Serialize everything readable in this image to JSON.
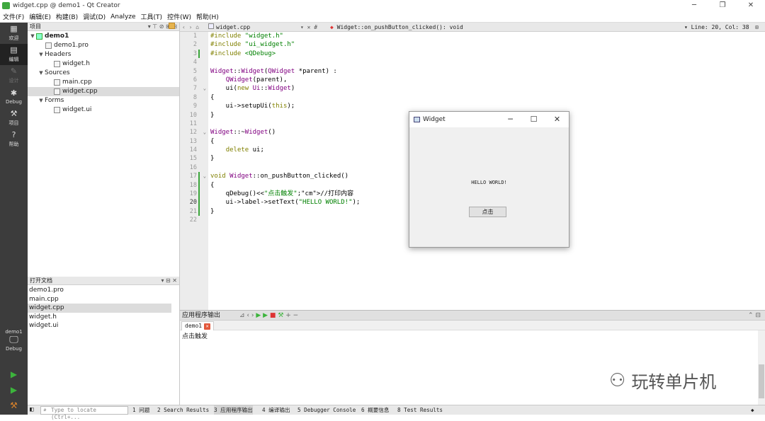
{
  "window": {
    "title": "widget.cpp @ demo1 - Qt Creator"
  },
  "menu": [
    "文件(F)",
    "编辑(E)",
    "构建(B)",
    "调试(D)",
    "Analyze",
    "工具(T)",
    "控件(W)",
    "帮助(H)"
  ],
  "modes": [
    {
      "label": "欢迎",
      "icon": "grid-icon"
    },
    {
      "label": "编辑",
      "icon": "edit-icon"
    },
    {
      "label": "设计",
      "icon": "pencil-icon"
    },
    {
      "label": "Debug",
      "icon": "bug-icon"
    },
    {
      "label": "项目",
      "icon": "wrench-icon"
    },
    {
      "label": "帮助",
      "icon": "help-icon"
    }
  ],
  "kit": {
    "project": "demo1",
    "config": "Debug"
  },
  "projects_pane": {
    "title": "项目",
    "tree": [
      {
        "label": "demo1",
        "level": 0,
        "kind": "project"
      },
      {
        "label": "demo1.pro",
        "level": 1,
        "kind": "file"
      },
      {
        "label": "Headers",
        "level": 1,
        "kind": "folder"
      },
      {
        "label": "widget.h",
        "level": 2,
        "kind": "file"
      },
      {
        "label": "Sources",
        "level": 1,
        "kind": "folder"
      },
      {
        "label": "main.cpp",
        "level": 2,
        "kind": "file"
      },
      {
        "label": "widget.cpp",
        "level": 2,
        "kind": "file"
      },
      {
        "label": "Forms",
        "level": 1,
        "kind": "folder"
      },
      {
        "label": "widget.ui",
        "level": 2,
        "kind": "file"
      }
    ]
  },
  "open_docs": {
    "title": "打开文档",
    "items": [
      "demo1.pro",
      "main.cpp",
      "widget.cpp",
      "widget.h",
      "widget.ui"
    ],
    "selected": "widget.cpp"
  },
  "editor": {
    "file": "widget.cpp",
    "symbol": "Widget::on_pushButton_clicked(): void",
    "position": "Line: 20, Col: 38",
    "current_line": 20
  },
  "code_lines": [
    "#include \"widget.h\"",
    "#include \"ui_widget.h\"",
    "#include <QDebug>",
    "",
    "Widget::Widget(QWidget *parent) :",
    "    QWidget(parent),",
    "    ui(new Ui::Widget)",
    "{",
    "    ui->setupUi(this);",
    "}",
    "",
    "Widget::~Widget()",
    "{",
    "    delete ui;",
    "}",
    "",
    "void Widget::on_pushButton_clicked()",
    "{",
    "    qDebug()<<\"点击触发\";//打印内容",
    "    ui->label->setText(\"HELLO WORLD!\");",
    "}",
    ""
  ],
  "output": {
    "title": "应用程序输出",
    "tab": "demo1",
    "text": "点击触发"
  },
  "statusbar": {
    "locate_placeholder": "Type to locate (Ctrl+...",
    "tabs": [
      "1 问题",
      "2 Search Results",
      "3 应用程序输出",
      "4 编译输出",
      "5 Debugger Console",
      "6 概要信息",
      "8 Test Results"
    ]
  },
  "dialog": {
    "title": "Widget",
    "label": "HELLO WORLD!",
    "button": "点击"
  },
  "watermark": "玩转单片机"
}
